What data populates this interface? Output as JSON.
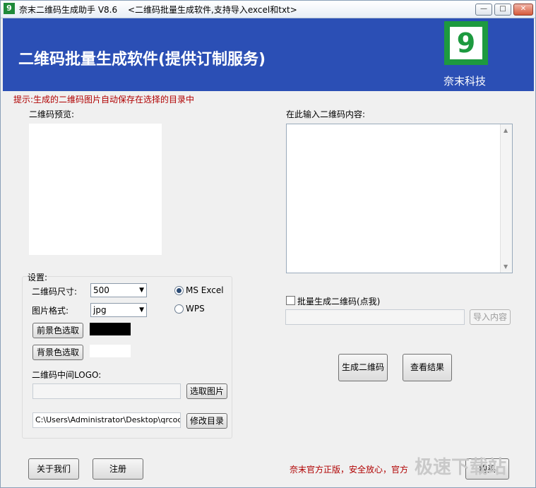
{
  "titlebar": {
    "app_title": "奈末二维码生成助手 V8.6",
    "subtitle": "<二维码批量生成软件,支持导入excel和txt>",
    "minimize": "—",
    "maximize": "□",
    "close": "✕"
  },
  "header": {
    "title": "二维码批量生成软件(提供订制服务)",
    "logo_glyph": "9",
    "company": "奈末科技",
    "bg_color": "#2b4fb5"
  },
  "tip": "提示:生成的二维码图片自动保存在选择的目录中",
  "preview_label": "二维码预览:",
  "content_label": "在此输入二维码内容:",
  "settings": {
    "legend": "设置:",
    "size_label": "二维码尺寸:",
    "size_value": "500",
    "format_label": "图片格式:",
    "format_value": "jpg",
    "radio_excel": "MS  Excel",
    "radio_wps": "WPS",
    "selected_radio": "MS  Excel",
    "fg_button": "前景色选取",
    "bg_button": "背景色选取",
    "fg_color": "#000000",
    "bg_color": "#ffffff",
    "logo_label": "二维码中间LOGO:",
    "logo_path": "",
    "select_image_button": "选取图片",
    "output_path": "C:\\Users\\Administrator\\Desktop\\qrcod",
    "change_dir_button": "修改目录"
  },
  "batch": {
    "checkbox_label": "批量生成二维码(点我)",
    "checked": false,
    "import_path": "",
    "import_button": "导入内容"
  },
  "actions": {
    "generate": "生成二维码",
    "view_result": "查看结果"
  },
  "footer": {
    "about": "关于我们",
    "register": "注册",
    "notice": "奈末官方正版，安全放心，官方",
    "tail_button": "购买",
    "watermark": "极速下载站"
  }
}
